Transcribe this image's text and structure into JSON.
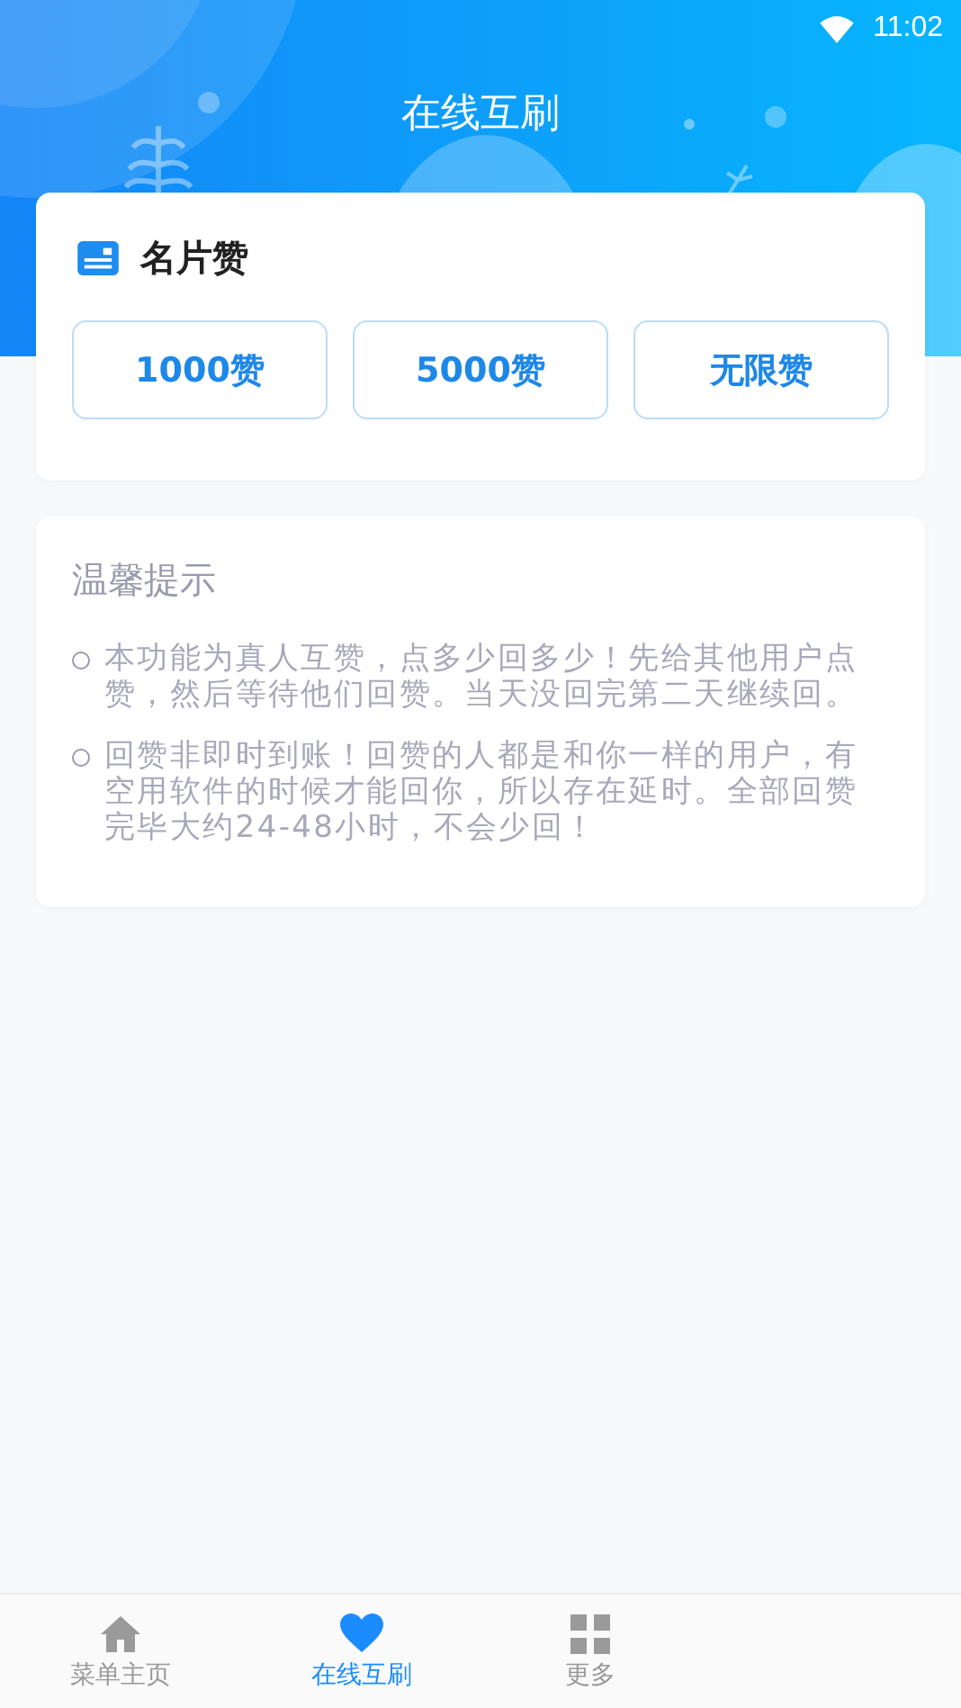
{
  "status_bar": {
    "time": "11:02"
  },
  "header": {
    "title": "在线互刷"
  },
  "like_card": {
    "title": "名片赞",
    "options": [
      {
        "label": "1000赞"
      },
      {
        "label": "5000赞"
      },
      {
        "label": "无限赞"
      }
    ]
  },
  "tips": {
    "title": "温馨提示",
    "items": [
      "本功能为真人互赞，点多少回多少！先给其他用户点赞，然后等待他们回赞。当天没回完第二天继续回。",
      "回赞非即时到账！回赞的人都是和你一样的用户，有空用软件的时候才能回你，所以存在延时。全部回赞完毕大约24-48小时，不会少回！"
    ]
  },
  "bottom_nav": [
    {
      "label": "菜单主页",
      "kind": "home",
      "selected": false
    },
    {
      "label": "在线互刷",
      "kind": "heart",
      "selected": true
    },
    {
      "label": "更多",
      "kind": "grid",
      "selected": false
    }
  ]
}
